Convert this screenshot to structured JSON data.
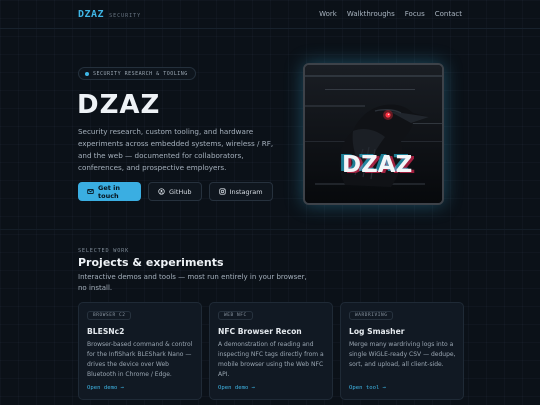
{
  "nav": {
    "logo": "DZAZ",
    "logo_sub": "SECURITY",
    "links": [
      "Work",
      "Walkthroughs",
      "Focus",
      "Contact"
    ]
  },
  "hero": {
    "badge": "SECURITY RESEARCH & TOOLING",
    "title": "DZAZ",
    "description": "Security research, custom tooling, and hardware experiments across embedded systems, wireless / RF, and the web — documented for collaborators, conferences, and prospective employers.",
    "buttons": {
      "primary": "Get in touch",
      "github": "GitHub",
      "instagram": "Instagram"
    },
    "image_text": "DZAZ"
  },
  "section": {
    "eyebrow": "SELECTED WORK",
    "title": "Projects & experiments",
    "description": "Interactive demos and tools — most run entirely in your browser, no install."
  },
  "cards": [
    {
      "tag": "BROWSER C2",
      "title": "BLESNc2",
      "description": "Browser-based command & control for the InfiShark BLEShark Nano — drives the device over Web Bluetooth in Chrome / Edge.",
      "link": "Open demo →"
    },
    {
      "tag": "WEB NFC",
      "title": "NFC Browser Recon",
      "description": "A demonstration of reading and inspecting NFC tags directly from a mobile browser using the Web NFC API.",
      "link": "Open demo →"
    },
    {
      "tag": "WARDRIVING",
      "title": "Log Smasher",
      "description": "Merge many wardriving logs into a single WiGLE-ready CSV — dedupe, sort, and upload, all client-side.",
      "link": "Open tool →"
    }
  ],
  "colors": {
    "accent": "#3fb6e6",
    "background": "#0b1118",
    "card": "#111923"
  }
}
